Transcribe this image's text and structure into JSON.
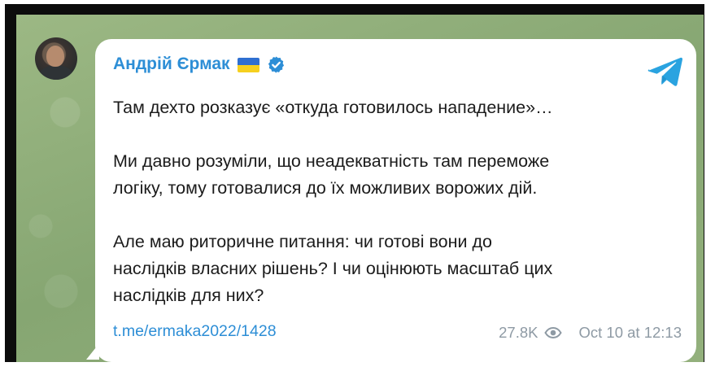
{
  "post": {
    "author": "Андрій Єрмак",
    "paragraphs": [
      [
        "Там дехто розказує «откуда готовилось нападение»…"
      ],
      [
        "Ми давно розуміли, що неадекватність там переможе",
        "логіку, тому готовалися до їх можливих ворожих дій."
      ],
      [
        "Але маю риторичне питання: чи готові вони до",
        "наслідків власних рішень? І чи оцінюють масштаб цих",
        "наслідків для них?"
      ]
    ],
    "link": "t.me/ermaka2022/1428",
    "views": "27.8K",
    "date": "Oct 10 at 12:13"
  },
  "icons": {
    "flag": "ukraine-flag-icon",
    "verified": "verified-badge-icon",
    "telegram": "telegram-logo-icon",
    "views": "eye-icon"
  },
  "colors": {
    "accent": "#2d8ed6",
    "background": "#8dad78",
    "meta": "#8e9aa4",
    "flag_blue": "#2f6fd1",
    "flag_yellow": "#f6d01f"
  }
}
